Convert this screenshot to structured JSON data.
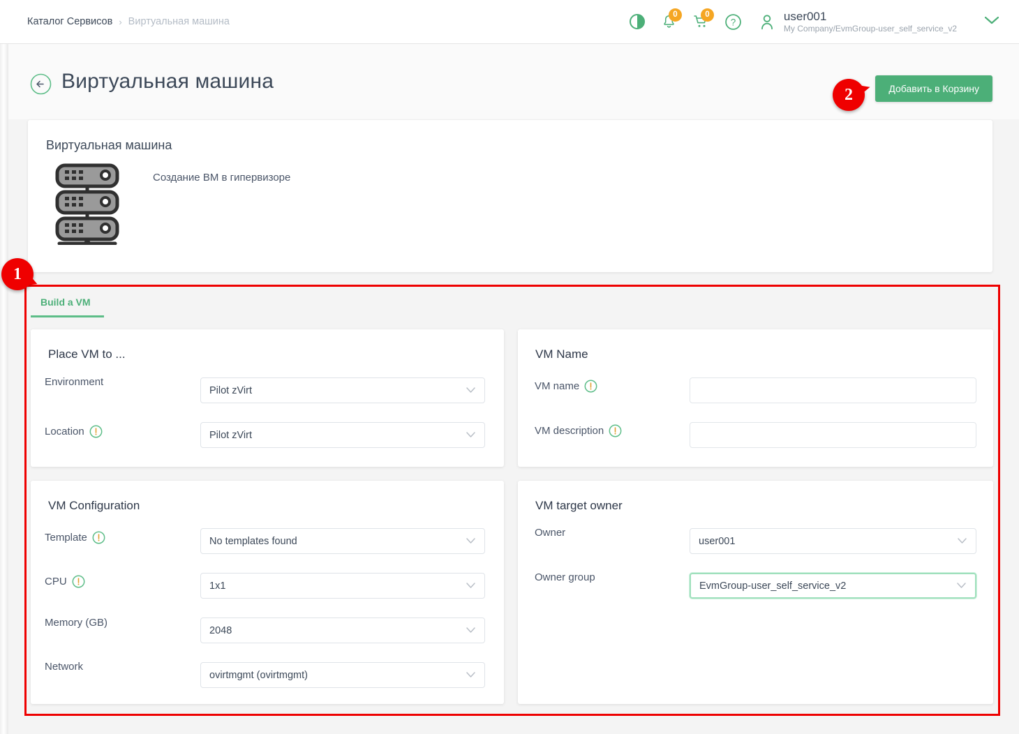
{
  "header": {
    "breadcrumb": {
      "root": "Каталог Сервисов",
      "separator": "›",
      "current": "Виртуальная машина"
    },
    "notifications_count": "0",
    "cart_count": "0",
    "user_name": "user001",
    "user_org": "My Company/EvmGroup-user_self_service_v2"
  },
  "page": {
    "title": "Виртуальная машина",
    "add_to_cart_label": "Добавить в Корзину"
  },
  "service_card": {
    "title": "Виртуальная машина",
    "description": "Создание ВМ в гипервизоре"
  },
  "tabs": [
    {
      "label": "Build a VM",
      "active": true
    }
  ],
  "annotations": [
    {
      "number": "1"
    },
    {
      "number": "2"
    }
  ],
  "panels": {
    "place_vm": {
      "title": "Place VM to ...",
      "fields": {
        "environment": {
          "label": "Environment",
          "value": "Pilot zVirt",
          "required": false
        },
        "location": {
          "label": "Location",
          "value": "Pilot zVirt",
          "required": true
        }
      }
    },
    "vm_name": {
      "title": "VM Name",
      "fields": {
        "vm_name": {
          "label": "VM name",
          "value": "",
          "placeholder": "",
          "required": true
        },
        "vm_description": {
          "label": "VM description",
          "value": "",
          "placeholder": "",
          "required": true
        }
      }
    },
    "vm_configuration": {
      "title": "VM Configuration",
      "fields": {
        "template": {
          "label": "Template",
          "value": "No templates found",
          "required": true
        },
        "cpu": {
          "label": "CPU",
          "value": "1x1",
          "required": true
        },
        "memory": {
          "label": "Memory (GB)",
          "value": "2048",
          "required": false
        },
        "network": {
          "label": "Network",
          "value": "ovirtmgmt (ovirtmgmt)",
          "required": false
        }
      }
    },
    "vm_target_owner": {
      "title": "VM target owner",
      "fields": {
        "owner": {
          "label": "Owner",
          "value": "user001",
          "required": false
        },
        "owner_group": {
          "label": "Owner group",
          "value": "EvmGroup-user_self_service_v2",
          "required": false,
          "focused": true
        }
      }
    }
  },
  "colors": {
    "accent_green": "#4caf78",
    "badge_orange": "#f5a623",
    "annotation_red": "#ee0000",
    "text_dark": "#3c4858",
    "page_bg": "#f4f4f4"
  },
  "icons": {
    "contrast": "contrast-icon",
    "bell": "bell-icon",
    "cart": "cart-icon",
    "help": "help-icon",
    "user": "user-icon",
    "chevron_down": "chevron-down-icon",
    "back_arrow": "back-arrow-icon",
    "server_stack": "server-stack-icon",
    "required_info": "required-info-icon"
  }
}
